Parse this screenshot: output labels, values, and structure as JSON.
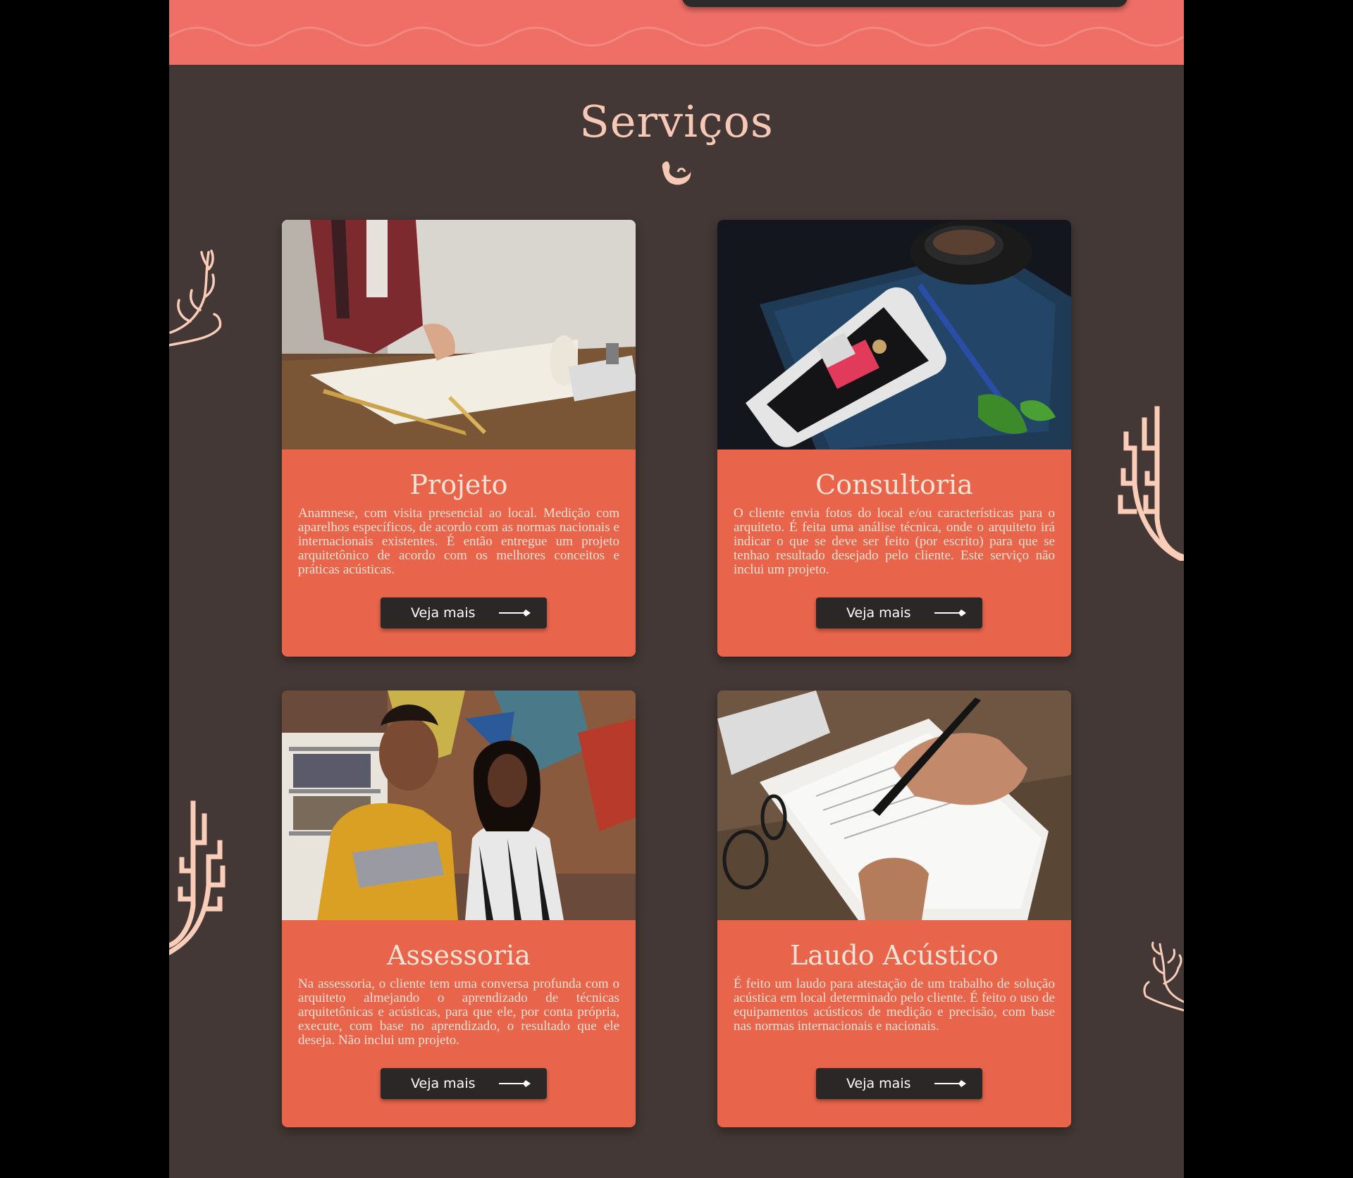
{
  "services": {
    "title": "Serviços",
    "cards": [
      {
        "title": "Projeto",
        "text": "Anamnese, com visita presencial ao local. Medição com aparelhos específicos, de acordo com as normas nacionais e internacionais existentes. É então entregue um projeto arquitetônico de acordo com os melhores conceitos e práticas acústicas.",
        "button_label": "Veja mais",
        "image": "architect-drawing-plans-photo"
      },
      {
        "title": "Consultoria",
        "text": "O cliente envia fotos do local e/ou características para o arquiteto. É feita uma análise técnica, onde o arquiteto irá indicar o que se deve ser feito (por escrito) para que se tenhao resultado desejado pelo cliente. Este serviço não inclui um projeto.",
        "button_label": "Veja mais",
        "image": "smartphone-notebook-coffee-photo"
      },
      {
        "title": "Assessoria",
        "text": "Na assessoria, o cliente tem uma conversa profunda com o arquiteto almejando o aprendizado de técnicas arquitetônicas e acústicas, para que ele, por conta própria, execute, com base no aprendizado, o resultado que ele deseja. Não inclui um projeto.",
        "button_label": "Veja mais",
        "image": "two-people-tablet-photo"
      },
      {
        "title": "Laudo Acústico",
        "text": "É feito um laudo para atestação de um trabalho de solução acústica em local determinado pelo cliente. É feito o uso de equipamentos acústicos de medição e precisão, com base nas normas internacionais e nacionais.",
        "button_label": "Veja mais",
        "image": "hand-signing-document-photo"
      }
    ]
  },
  "colors": {
    "page_bg": "#433836",
    "top_band": "#ef6f66",
    "card_bg": "#e8654c",
    "title": "#f7c8b5",
    "button_bg": "#2c2727",
    "coral": "#f9cdb8"
  }
}
